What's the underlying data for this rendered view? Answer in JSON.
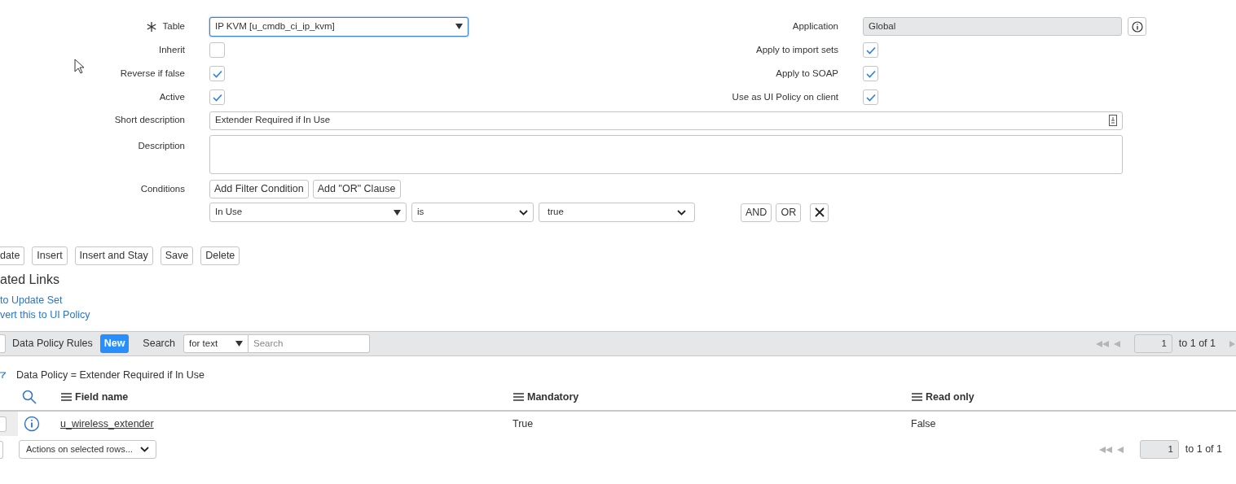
{
  "form": {
    "left_fields": [
      {
        "kind": "select",
        "label": "Table",
        "mandatory": true,
        "value": "IP KVM [u_cmdb_ci_ip_kvm]",
        "focused": true
      },
      {
        "kind": "checkbox",
        "label": "Inherit",
        "checked": false
      },
      {
        "kind": "checkbox",
        "label": "Reverse if false",
        "checked": true
      },
      {
        "kind": "checkbox",
        "label": "Active",
        "checked": true
      }
    ],
    "right_fields": [
      {
        "kind": "readonly",
        "label": "Application",
        "value": "Global"
      },
      {
        "kind": "checkbox",
        "label": "Apply to import sets",
        "checked": true
      },
      {
        "kind": "checkbox",
        "label": "Apply to SOAP",
        "checked": true
      },
      {
        "kind": "checkbox",
        "label": "Use as UI Policy on client",
        "checked": true
      }
    ],
    "short_description": {
      "label": "Short description",
      "value": "Extender Required if In Use"
    },
    "description": {
      "label": "Description"
    },
    "conditions": {
      "label": "Conditions",
      "buttons": [
        "Add Filter Condition",
        "Add \"OR\" Clause"
      ],
      "field": "In Use",
      "operator": "is",
      "value": "true",
      "joins": [
        "AND",
        "OR"
      ]
    }
  },
  "actions": [
    "date",
    "Insert",
    "Insert and Stay",
    "Save",
    "Delete"
  ],
  "related_links": {
    "title": "ated Links",
    "links": [
      "to Update Set",
      "vert this to UI Policy"
    ]
  },
  "list": {
    "title": "Data Policy Rules",
    "new_button": "New",
    "search_label": "Search",
    "search_scope": "for text",
    "search_placeholder": "Search",
    "page": "1",
    "range": "to 1 of 1",
    "filter": "Data Policy = Extender Required if In Use",
    "columns": [
      "Field name",
      "Mandatory",
      "Read only"
    ],
    "rows": [
      {
        "checked": false,
        "field_name": "u_wireless_extender",
        "mandatory": "True",
        "read_only": "False"
      }
    ],
    "select_all_checked": false,
    "actions_select": "Actions on selected rows...",
    "footer_page": "1",
    "footer_range": "to 1 of 1"
  }
}
